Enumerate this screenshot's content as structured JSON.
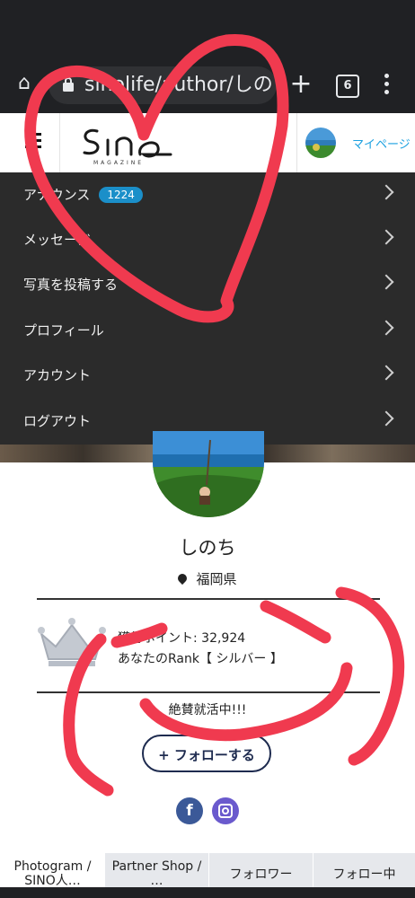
{
  "browser": {
    "url": "sinolife/author/しの",
    "tab_count": "6",
    "icons": [
      "home-icon",
      "lock-icon",
      "plus-icon",
      "tabs-icon",
      "more-vert-icon"
    ]
  },
  "header": {
    "logo_text": "SINO",
    "logo_sub": "MAGAZINE",
    "mypage_label": "マイページ"
  },
  "menu": {
    "items": [
      {
        "label": "アナウンス",
        "badge": "1224"
      },
      {
        "label": "メッセージ"
      },
      {
        "label": "写真を投稿する"
      },
      {
        "label": "プロフィール"
      },
      {
        "label": "アカウント"
      },
      {
        "label": "ログアウト"
      }
    ]
  },
  "profile": {
    "name": "しのち",
    "location": "福岡県",
    "points": "獲得ポイント: 32,924",
    "rank": "あなたのRank【 シルバー 】",
    "bio": "絶賛就活中!!!",
    "follow_label": "+ フォローする",
    "facebook_glyph": "f"
  },
  "tabs": [
    {
      "label": "Photogram / SINO人…"
    },
    {
      "label": "Partner Shop / …"
    },
    {
      "label": "フォロワー"
    },
    {
      "label": "フォロー中"
    }
  ],
  "colors": {
    "accent": "#1aa0e0",
    "menu_bg": "#2b2b2b",
    "badge": "#1b8fc9",
    "follow_border": "#1e2b4f",
    "scribble": "#f03a4f"
  }
}
